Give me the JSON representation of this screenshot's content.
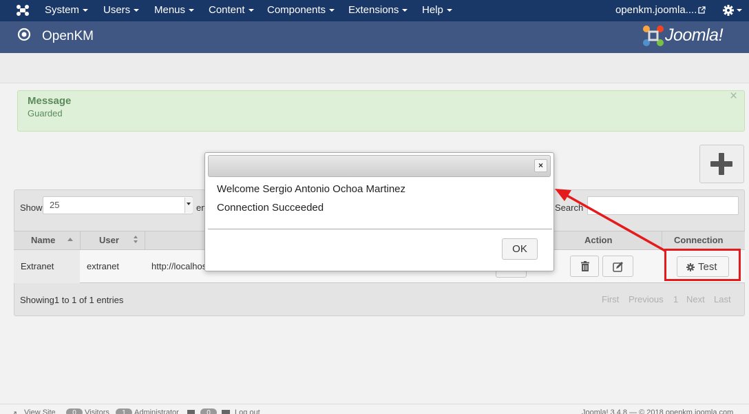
{
  "topbar": {
    "menus": [
      {
        "label": "System"
      },
      {
        "label": "Users"
      },
      {
        "label": "Menus"
      },
      {
        "label": "Content"
      },
      {
        "label": "Components"
      },
      {
        "label": "Extensions"
      },
      {
        "label": "Help"
      }
    ],
    "site_link": "openkm.joomla....",
    "bg_color": "#1a3867"
  },
  "header": {
    "title": "OpenKM",
    "logo_text": "Joomla!",
    "bg_color": "#3f5782"
  },
  "alert": {
    "title": "Message",
    "text": "Guarded",
    "close": "×"
  },
  "table": {
    "show_label": "Show",
    "length_value": "25",
    "entries_label": "en",
    "search_label": "Search",
    "columns": {
      "name": "Name",
      "user": "User",
      "action": "Action",
      "connection": "Connection"
    },
    "rows": [
      {
        "name": "Extranet",
        "user": "extranet",
        "url": "http://localhos",
        "test_label": "Test"
      }
    ],
    "info": "Showing1 to 1 of 1 entries",
    "pagination": {
      "first": "First",
      "previous": "Previous",
      "page": "1",
      "next": "Next",
      "last": "Last"
    }
  },
  "modal": {
    "line1": "Welcome Sergio Antonio Ochoa Martinez",
    "line2": "Connection Succeeded",
    "ok_label": "OK",
    "close_glyph": "×"
  },
  "statusbar": {
    "view_site": "View Site",
    "visitors_count": "0",
    "visitors": "Visitors",
    "admin_count": "1",
    "administrator": "Administrator",
    "messages_count": "0",
    "logout": "Log out",
    "version": "Joomla! 3.4.8 — © 2018 openkm.joomla.com"
  },
  "colors": {
    "highlight": "#e41a1c",
    "alert_bg": "#dff0d8"
  },
  "icons": [
    "joomla-icon",
    "external-link-icon",
    "gear-icon",
    "target-icon",
    "plus-icon",
    "trash-icon",
    "edit-icon",
    "cog-icon",
    "close-icon"
  ]
}
